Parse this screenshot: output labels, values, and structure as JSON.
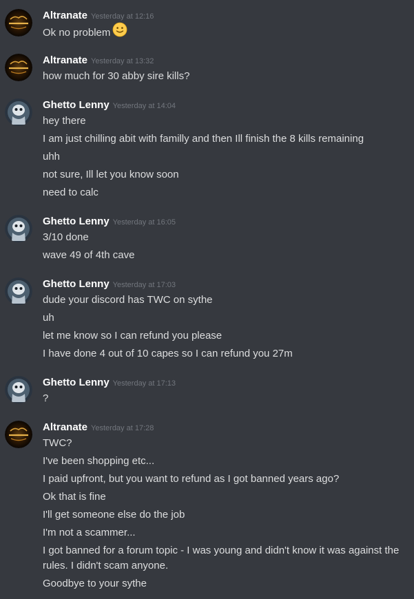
{
  "theme": {
    "background": "#36393f",
    "username_color": "#ffffff",
    "text_color": "#dcddde",
    "timestamp_color": "#72767d"
  },
  "groups": [
    {
      "author": "Altranate",
      "avatar": "altranate-avatar",
      "timestamp": "Yesterday at 12:16",
      "messages": [
        "Ok no problem"
      ],
      "emoji": "slight-smile-emoji"
    },
    {
      "author": "Altranate",
      "avatar": "altranate-avatar",
      "timestamp": "Yesterday at 13:32",
      "messages": [
        "how much for 30 abby sire kills?"
      ]
    },
    {
      "author": "Ghetto Lenny",
      "avatar": "ghetto-lenny-avatar",
      "timestamp": "Yesterday at 14:04",
      "messages": [
        "hey there",
        "I am just chilling abit with familly and then Ill finish the 8 kills remaining",
        "uhh",
        "not sure, Ill let you know soon",
        "need to calc"
      ]
    },
    {
      "author": "Ghetto Lenny",
      "avatar": "ghetto-lenny-avatar",
      "timestamp": "Yesterday at 16:05",
      "messages": [
        "3/10 done",
        "wave 49 of 4th cave"
      ]
    },
    {
      "author": "Ghetto Lenny",
      "avatar": "ghetto-lenny-avatar",
      "timestamp": "Yesterday at 17:03",
      "messages": [
        "dude your discord has TWC on sythe",
        "uh",
        "let me know so I can refund you please",
        "I have done 4 out of 10 capes so I can refund you 27m"
      ]
    },
    {
      "author": "Ghetto Lenny",
      "avatar": "ghetto-lenny-avatar",
      "timestamp": "Yesterday at 17:13",
      "messages": [
        "?"
      ]
    },
    {
      "author": "Altranate",
      "avatar": "altranate-avatar",
      "timestamp": "Yesterday at 17:28",
      "messages": [
        "TWC?",
        "I've been shopping etc...",
        "I paid upfront, but you want to refund as I got banned years ago?",
        "Ok that is fine",
        "I'll get someone else do the job",
        "I'm not a scammer...",
        "I got banned for a forum topic - I was young and didn't know it was against the rules. I didn't scam anyone.",
        "Goodbye to your sythe"
      ]
    }
  ]
}
